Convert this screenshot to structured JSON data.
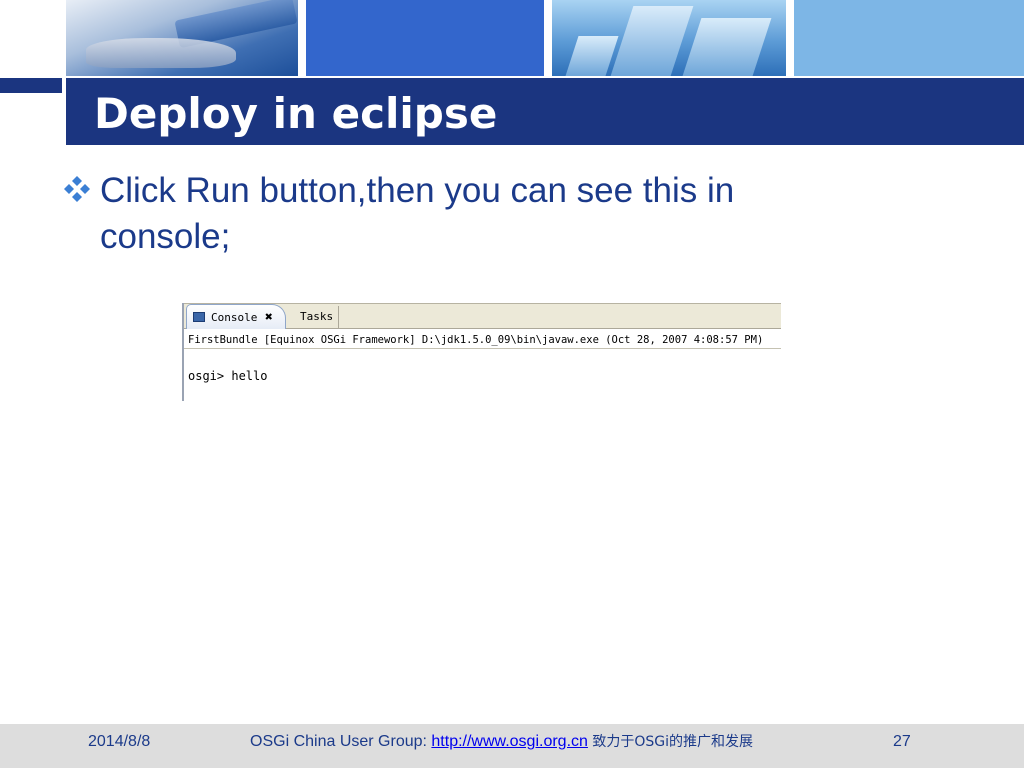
{
  "slide": {
    "title": "Deploy in eclipse",
    "bullet": "Click Run button,then you can see this in console;"
  },
  "console_view": {
    "tabs": [
      {
        "label": "Console",
        "active": true
      },
      {
        "label": "Tasks",
        "active": false
      }
    ],
    "close_glyph": "✖",
    "run_description": "FirstBundle [Equinox OSGi Framework] D:\\jdk1.5.0_09\\bin\\javaw.exe (Oct 28, 2007 4:08:57 PM)",
    "output_line": "osgi> hello"
  },
  "footer": {
    "date": "2014/8/8",
    "group_label": "OSGi China User Group: ",
    "link_text": "http://www.osgi.org.cn",
    "tagline": " 致力于OSGi的推广和发展",
    "page_number": "27"
  },
  "colors": {
    "title_band": "#1b3580",
    "body_text": "#1b3a8a",
    "footer_band": "#dddddd"
  },
  "icons": {
    "bullet": "four-diamond-bullet-icon",
    "console_tab": "console-icon",
    "close": "close-icon"
  }
}
